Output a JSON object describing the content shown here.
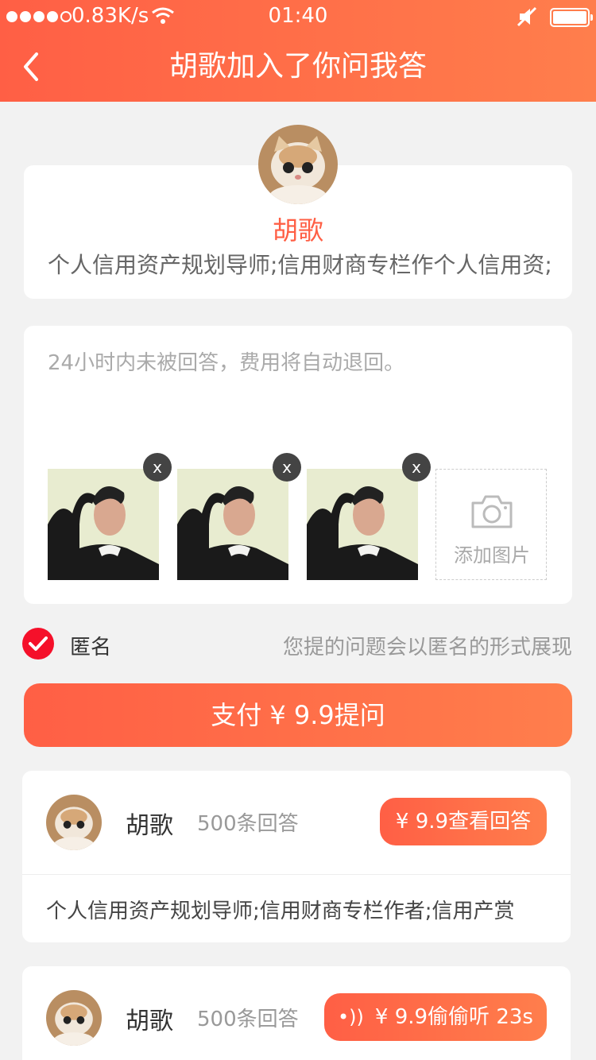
{
  "status_bar": {
    "network_speed": "0.83K/s",
    "time": "01:40"
  },
  "nav": {
    "title": "胡歌加入了你问我答"
  },
  "profile": {
    "name": "胡歌",
    "description": "个人信用资产规划导师;信用财商专栏作个人信用资;"
  },
  "question": {
    "placeholder": "24小时内未被回答，费用将自动退回。",
    "delete_label": "x",
    "add_picture_label": "添加图片"
  },
  "anonymous": {
    "label": "匿名",
    "tip": "您提的问题会以匿名的形式展现"
  },
  "pay_button": {
    "label": "支付 ¥ 9.9提问"
  },
  "answers": [
    {
      "name": "胡歌",
      "count": "500条回答",
      "button": "¥ 9.9查看回答",
      "description": "个人信用资产规划导师;信用财商专栏作者;信用产赏"
    },
    {
      "name": "胡歌",
      "count": "500条回答",
      "button": "¥ 9.9偷偷听 23s"
    }
  ],
  "colors": {
    "brand": "#ff5f45",
    "brand_end": "#ff7e4c",
    "check": "#f5102a"
  },
  "icons": [
    "signal-icon",
    "wifi-icon",
    "mute-icon",
    "battery-icon",
    "back-icon",
    "camera-icon",
    "check-icon",
    "close-icon",
    "audio-icon"
  ]
}
